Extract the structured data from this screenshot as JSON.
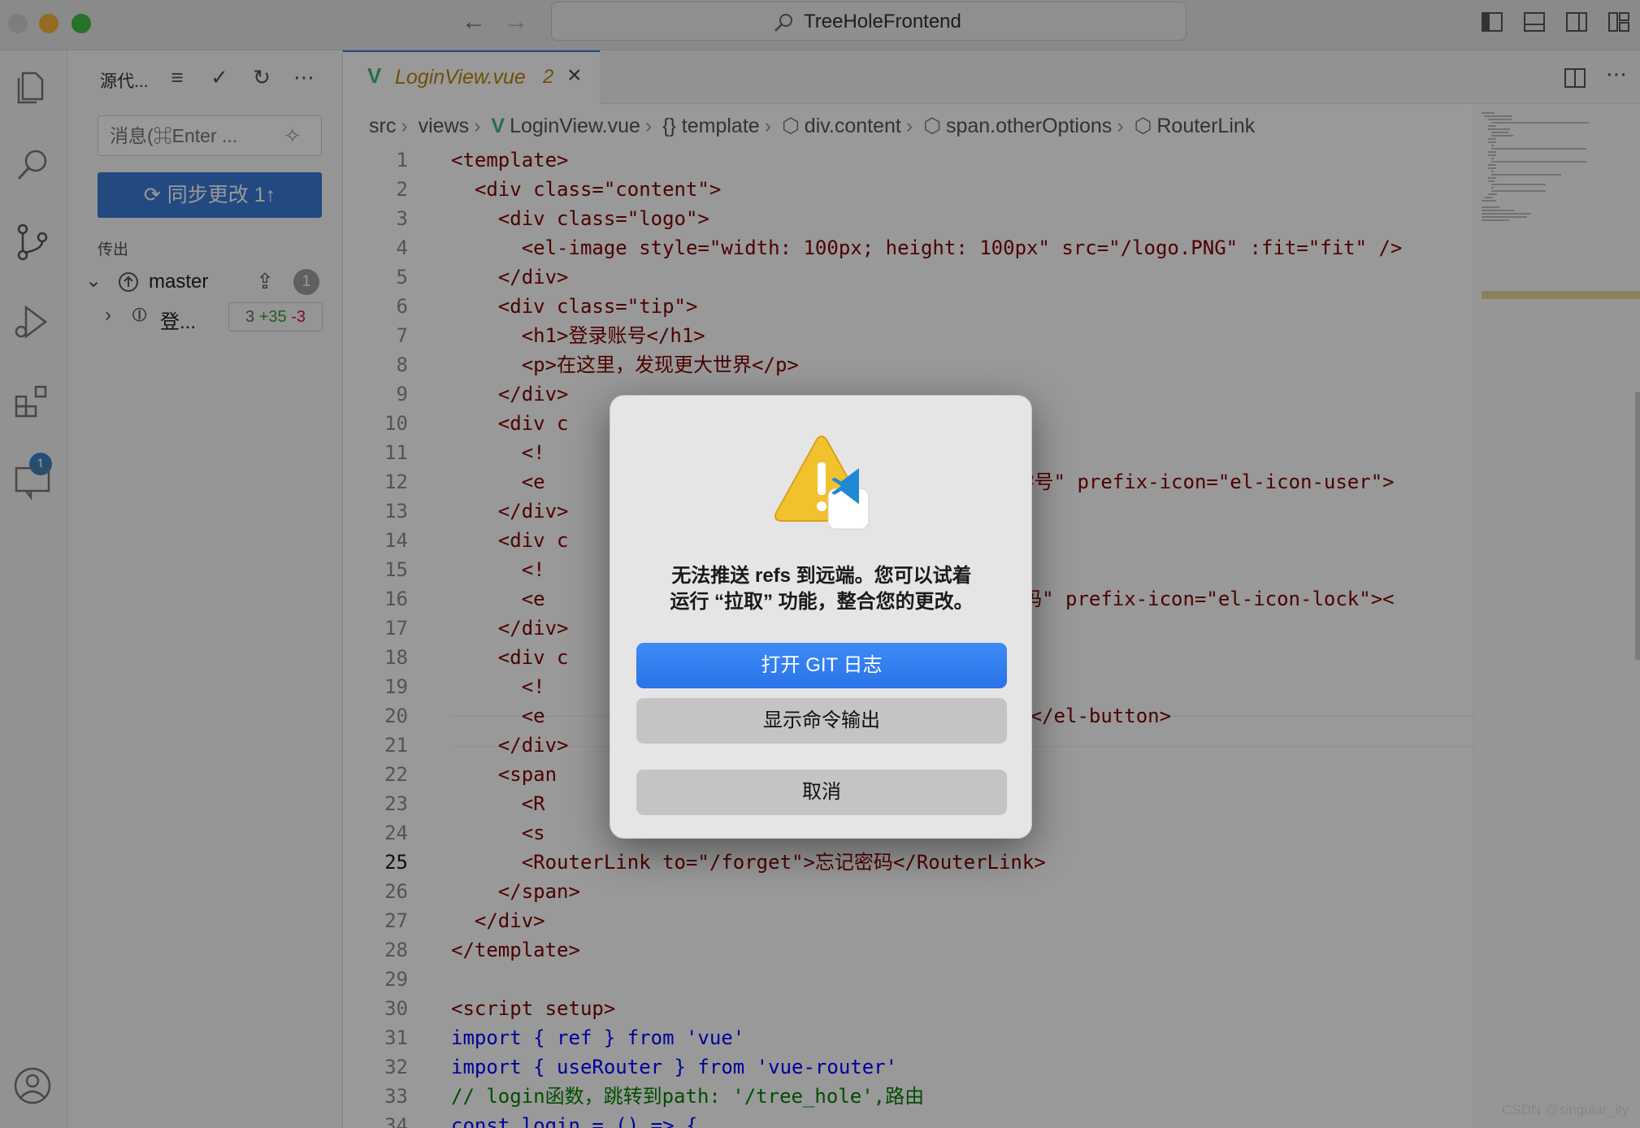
{
  "window": {
    "title": "TreeHoleFrontend"
  },
  "colors": {
    "accent": "#3a7bd5",
    "warning": "#f2c12e",
    "vue": "#41b883"
  },
  "activitybar": {
    "items": [
      "files-icon",
      "search-icon",
      "source-control-icon",
      "run-debug-icon",
      "extensions-icon",
      "remote-icon"
    ],
    "extensions_badge": "1",
    "account_icon": "account-icon"
  },
  "sidebar": {
    "title": "源代...",
    "message_placeholder": "消息(⌘Enter ...",
    "sync_button": "同步更改 1↑",
    "section_outgoing": "传出",
    "branch": {
      "name": "master",
      "count": "1"
    },
    "commit": {
      "label": "登...",
      "stats_files": "3",
      "stats_add": "+35",
      "stats_del": "-3"
    }
  },
  "editor": {
    "tab": {
      "name": "LoginView.vue",
      "problems": "2"
    },
    "breadcrumb": [
      "src",
      "views",
      "LoginView.vue",
      "{} template",
      "div.content",
      "span.otherOptions",
      "RouterLink"
    ],
    "active_line": "25",
    "lines": [
      {
        "n": "1",
        "code": "<template>"
      },
      {
        "n": "2",
        "code": "  <div class=\"content\">"
      },
      {
        "n": "3",
        "code": "    <div class=\"logo\">"
      },
      {
        "n": "4",
        "code": "      <el-image style=\"width: 100px; height: 100px\" src=\"/logo.PNG\" :fit=\"fit\" />"
      },
      {
        "n": "5",
        "code": "    </div>"
      },
      {
        "n": "6",
        "code": "    <div class=\"tip\">"
      },
      {
        "n": "7",
        "code": "      <h1>登录账号</h1>"
      },
      {
        "n": "8",
        "code": "      <p>在这里，发现更大世界</p>"
      },
      {
        "n": "9",
        "code": "    </div>"
      },
      {
        "n": "10",
        "code": "    <div c"
      },
      {
        "n": "11",
        "code": "      <!"
      },
      {
        "n": "12",
        "code": "      <e                                  lder=\"学号\" prefix-icon=\"el-icon-user\">"
      },
      {
        "n": "13",
        "code": "    </div>"
      },
      {
        "n": "14",
        "code": "    <div c"
      },
      {
        "n": "15",
        "code": "      <!"
      },
      {
        "n": "16",
        "code": "      <e                                  der=\"密码\" prefix-icon=\"el-icon-lock\"><"
      },
      {
        "n": "17",
        "code": "    </div>"
      },
      {
        "n": "18",
        "code": "    <div c"
      },
      {
        "n": "19",
        "code": "      <!"
      },
      {
        "n": "20",
        "code": "      <e                                  in\">登录</el-button>"
      },
      {
        "n": "21",
        "code": "    </div>"
      },
      {
        "n": "22",
        "code": "    <span"
      },
      {
        "n": "23",
        "code": "      <R                                  rLink>"
      },
      {
        "n": "24",
        "code": "      <s"
      },
      {
        "n": "25",
        "code": "      <RouterLink to=\"/forget\">忘记密码</RouterLink>"
      },
      {
        "n": "26",
        "code": "    </span>"
      },
      {
        "n": "27",
        "code": "  </div>"
      },
      {
        "n": "28",
        "code": "</template>"
      },
      {
        "n": "29",
        "code": ""
      },
      {
        "n": "30",
        "code": "<script setup>"
      },
      {
        "n": "31",
        "code": "import { ref } from 'vue'"
      },
      {
        "n": "32",
        "code": "import { useRouter } from 'vue-router'"
      },
      {
        "n": "33",
        "code": "// login函数，跳转到path: '/tree_hole',路由"
      },
      {
        "n": "34",
        "code": "const login = () => {"
      }
    ]
  },
  "dialog": {
    "message_line1": "无法推送 refs 到远端。您可以试着",
    "message_line2": "运行 “拉取” 功能，整合您的更改。",
    "primary_button": "打开 GIT 日志",
    "secondary_button": "显示命令输出",
    "cancel_button": "取消"
  },
  "watermark": "CSDN @singular_ity"
}
